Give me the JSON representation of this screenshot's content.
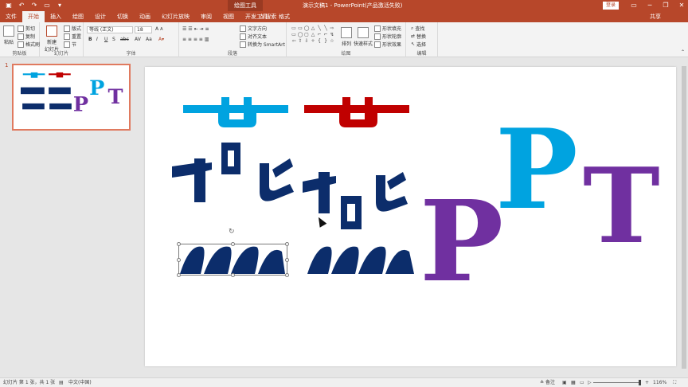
{
  "titlebar": {
    "context_tab": "绘图工具",
    "title": "演示文稿1 - PowerPoint(产品激活失败)",
    "login": "登录",
    "qat_icons": [
      "save-icon",
      "undo-icon",
      "redo-icon",
      "start-icon",
      "dropdown-icon"
    ],
    "controls": [
      "▭",
      "─",
      "❐",
      "✕"
    ]
  },
  "tabs": [
    "文件",
    "开始",
    "插入",
    "绘图",
    "设计",
    "切换",
    "动画",
    "幻灯片放映",
    "审阅",
    "视图",
    "开发工具",
    "格式"
  ],
  "tell_me": "搜索",
  "share": "共享",
  "ribbon": {
    "clipboard": {
      "label": "剪贴板",
      "paste": "粘贴",
      "cut": "剪切",
      "copy": "复制",
      "format_painter": "格式刷"
    },
    "slides": {
      "label": "幻灯片",
      "new_slide": "新建\n幻灯片",
      "layout": "版式",
      "reset": "重置",
      "section": "节"
    },
    "font": {
      "label": "字体",
      "font_name": "等线 (正文)",
      "font_size": "18",
      "bold": "B",
      "italic": "I",
      "underline": "U",
      "strike": "S",
      "shadow": "abc",
      "spacing": "AV",
      "case": "Aa"
    },
    "paragraph": {
      "label": "段落",
      "text_direction": "文字方向",
      "align_text": "对齐文本",
      "smartart": "转换为 SmartArt"
    },
    "drawing": {
      "label": "绘图",
      "arrange": "排列",
      "quick_styles": "快速样式",
      "fill": "形状填充",
      "outline": "形状轮廓",
      "effects": "形状效果"
    },
    "editing": {
      "label": "编辑",
      "find": "查找",
      "replace": "替换",
      "select": "选择"
    }
  },
  "thumb": {
    "number": "1"
  },
  "slide": {
    "glyph_p1": "P",
    "glyph_p2": "P",
    "glyph_t": "T"
  },
  "colors": {
    "navy": "#0c2d6b",
    "sky": "#00a3e0",
    "red": "#c00000",
    "purple": "#7030a0",
    "accent": "#b7472a"
  },
  "status": {
    "slide_info": "幻灯片 第 1 张，共 1 张",
    "language": "中文(中国)",
    "notes": "备注",
    "zoom": "116%"
  }
}
